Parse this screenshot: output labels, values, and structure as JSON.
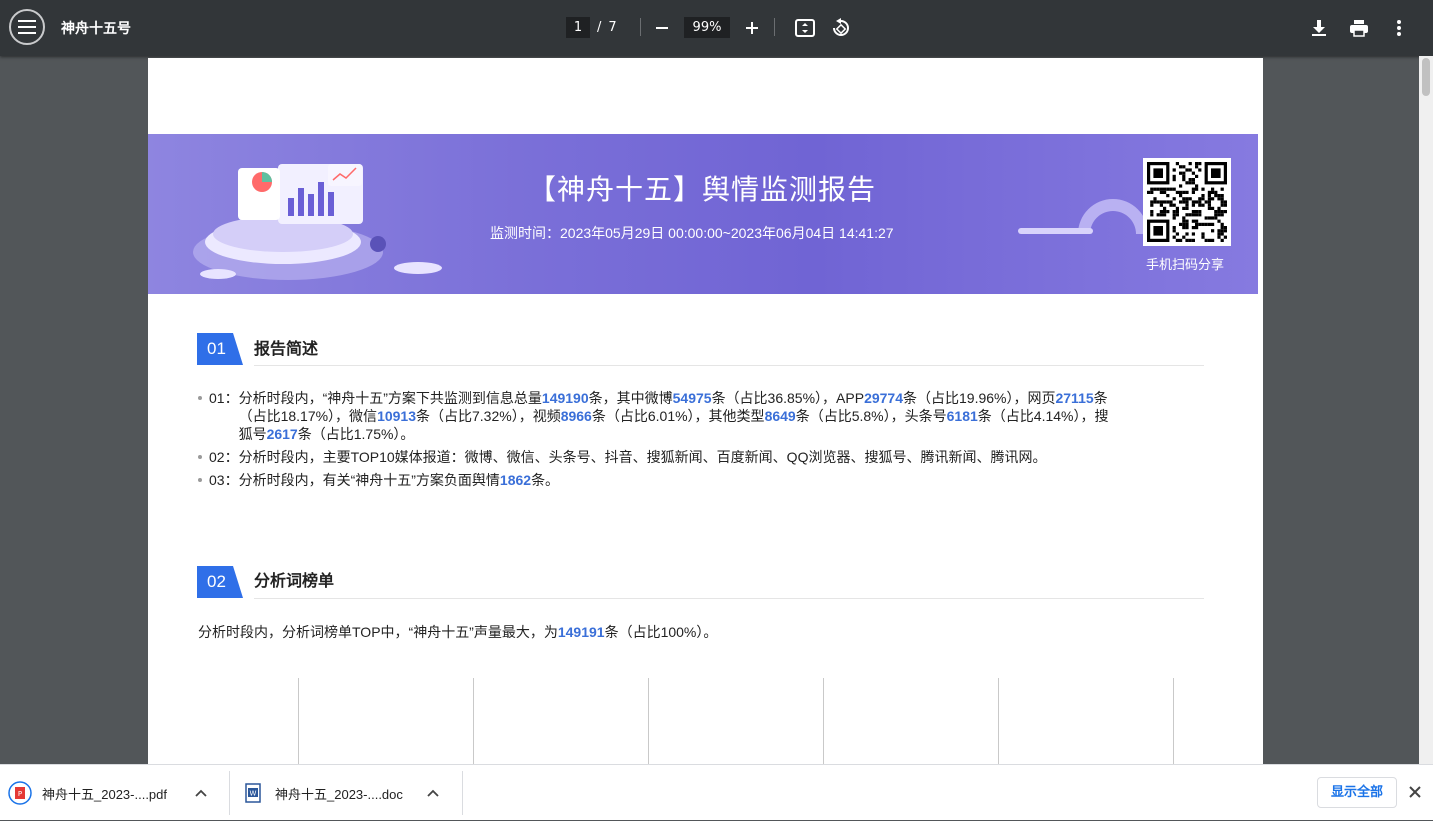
{
  "toolbar": {
    "title": "神舟十五号",
    "current_page": "1",
    "page_sep": "/",
    "total_pages": "7",
    "zoom": "99%"
  },
  "banner": {
    "title": "【神舟十五】舆情监测报告",
    "time": "监测时间：2023年05月29日 00:00:00~2023年06月04日 14:41:27",
    "qr_caption": "手机扫码分享"
  },
  "section1": {
    "num": "01",
    "title": "报告简述",
    "items": [
      {
        "prefix": "01：",
        "parts": [
          {
            "t": "分析时段内，“神舟十五”方案下共监测到信息总量"
          },
          {
            "h": "149190"
          },
          {
            "t": "条，其中微博"
          },
          {
            "h": "54975"
          },
          {
            "t": "条（占比36.85%），APP"
          },
          {
            "h": "29774"
          },
          {
            "t": "条（占比19.96%），网页"
          },
          {
            "h": "27115"
          },
          {
            "t": "条"
          }
        ],
        "line2": [
          {
            "t": "（占比18.17%），微信"
          },
          {
            "h": "10913"
          },
          {
            "t": "条（占比7.32%），视频"
          },
          {
            "h": "8966"
          },
          {
            "t": "条（占比6.01%），其他类型"
          },
          {
            "h": "8649"
          },
          {
            "t": "条（占比5.8%），头条号"
          },
          {
            "h": "6181"
          },
          {
            "t": "条（占比4.14%），搜"
          }
        ],
        "line3": [
          {
            "t": "狐号"
          },
          {
            "h": "2617"
          },
          {
            "t": "条（占比1.75%）。"
          }
        ]
      },
      {
        "prefix": "02：",
        "text": "分析时段内，主要TOP10媒体报道：微博、微信、头条号、抖音、搜狐新闻、百度新闻、QQ浏览器、搜狐号、腾讯新闻、腾讯网。"
      },
      {
        "prefix": "03：",
        "before": "分析时段内，有关“神舟十五”方案负面舆情",
        "num": "1862",
        "after": "条。"
      }
    ]
  },
  "section2": {
    "num": "02",
    "title": "分析词榜单",
    "before": "分析时段内，分析词榜单TOP中，“神舟十五”声量最大，为",
    "num_value": "149191",
    "after": "条（占比100%）。"
  },
  "downloads": [
    {
      "name": "神舟十五_2023-....pdf",
      "icon": "pdf-file-icon"
    },
    {
      "name": "神舟十五_2023-....doc",
      "icon": "word-file-icon"
    }
  ],
  "show_all_label": "显示全部",
  "colors": {
    "toolbar_bg": "#323639",
    "viewer_bg": "#525659",
    "banner": "#7a6fd8",
    "section_badge": "#2f6fe8",
    "highlight": "#3a6fd8"
  }
}
